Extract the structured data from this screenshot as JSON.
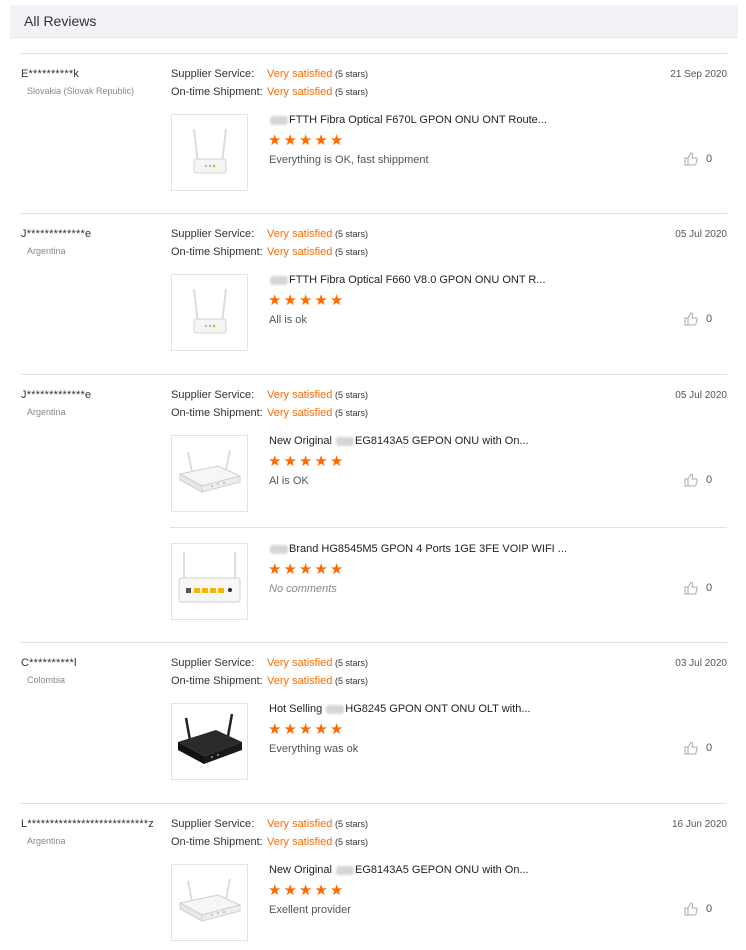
{
  "header": {
    "title": "All Reviews"
  },
  "labels": {
    "supplier_service": "Supplier Service:",
    "ontime_shipment": "On-time Shipment:",
    "rating_value": "Very satisfied",
    "rating_stars": "(5 stars)"
  },
  "accent_color": "#ff6a00",
  "reviews": [
    {
      "buyer": "E**********k",
      "country": "Slovakia (Slovak Republic)",
      "date": "21 Sep 2020",
      "items": [
        {
          "product_pre": "",
          "product": "FTTH Fibra Optical F670L GPON ONU ONT Route...",
          "rating": 5,
          "comment": "Everything is OK, fast shippment",
          "likes": "0",
          "thumb": "router-white-vertical"
        }
      ]
    },
    {
      "buyer": "J*************e",
      "country": "Argentina",
      "date": "05 Jul 2020",
      "items": [
        {
          "product_pre": "",
          "product": "FTTH Fibra Optical F660 V8.0 GPON ONU ONT R...",
          "rating": 5,
          "comment": "All is ok",
          "likes": "0",
          "thumb": "router-white-vertical"
        }
      ]
    },
    {
      "buyer": "J*************e",
      "country": "Argentina",
      "date": "05 Jul 2020",
      "items": [
        {
          "product_pre": "New Original",
          "product": "EG8143A5 GEPON ONU with On...",
          "rating": 5,
          "comment": "Al is OK",
          "likes": "0",
          "thumb": "router-white-flat"
        },
        {
          "product_pre": "",
          "product": "Brand HG8545M5 GPON 4 Ports 1GE 3FE VOIP WIFI ...",
          "rating": 5,
          "comment": "No comments",
          "likes": "0",
          "thumb": "router-white-ports"
        }
      ]
    },
    {
      "buyer": "C**********l",
      "country": "Colombia",
      "date": "03 Jul 2020",
      "items": [
        {
          "product_pre": "Hot Selling",
          "product": "HG8245 GPON ONT ONU OLT with...",
          "rating": 5,
          "comment": "Everything was ok",
          "likes": "0",
          "thumb": "router-black"
        }
      ]
    },
    {
      "buyer": "L***************************z",
      "country": "Argentina",
      "date": "16 Jun 2020",
      "items": [
        {
          "product_pre": "New Original",
          "product": "EG8143A5 GEPON ONU with On...",
          "rating": 5,
          "comment": "Exellent provider",
          "likes": "0",
          "thumb": "router-white-flat"
        }
      ]
    }
  ]
}
